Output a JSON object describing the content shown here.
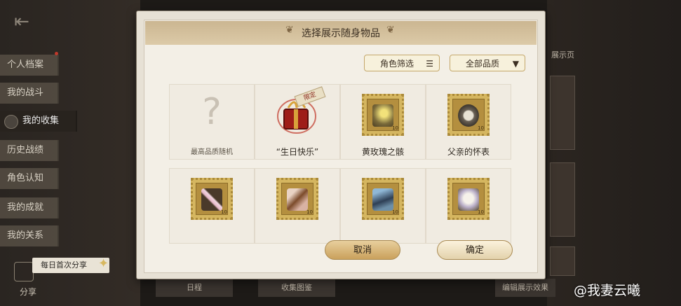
{
  "sidebar": {
    "items": [
      {
        "label": "个人档案"
      },
      {
        "label": "我的战斗"
      },
      {
        "label": "我的收集"
      },
      {
        "label": "历史战绩"
      },
      {
        "label": "角色认知"
      },
      {
        "label": "我的成就"
      },
      {
        "label": "我的关系"
      }
    ],
    "share_hint": "每日首次分享",
    "share_label": "分享"
  },
  "background": {
    "right_label": "展示页",
    "bottom_tab_1": "日程",
    "bottom_tab_2": "收集图鉴",
    "bottom_tab_3": "编辑展示效果"
  },
  "modal": {
    "title": "选择展示随身物品",
    "filter_role_label": "角色筛选",
    "filter_quality_label": "全部品质",
    "items": [
      {
        "label": "最高品质随机"
      },
      {
        "label": "“生日快乐”",
        "badge": "限定"
      },
      {
        "label": "黄玫瑰之骸",
        "value": "10"
      },
      {
        "label": "父亲的怀表",
        "value": "10"
      },
      {
        "label": "",
        "value": "10"
      },
      {
        "label": "",
        "value": "10"
      },
      {
        "label": "",
        "value": "10"
      },
      {
        "label": "",
        "value": "10"
      }
    ],
    "cancel_label": "取消",
    "confirm_label": "确定"
  },
  "watermark": "@我妻云曦",
  "colors": {
    "title_bar": "#cbb691",
    "cancel_button": "#d9b87a",
    "confirm_button": "#f3e7c9",
    "stamp_gold": "#d5b660"
  }
}
